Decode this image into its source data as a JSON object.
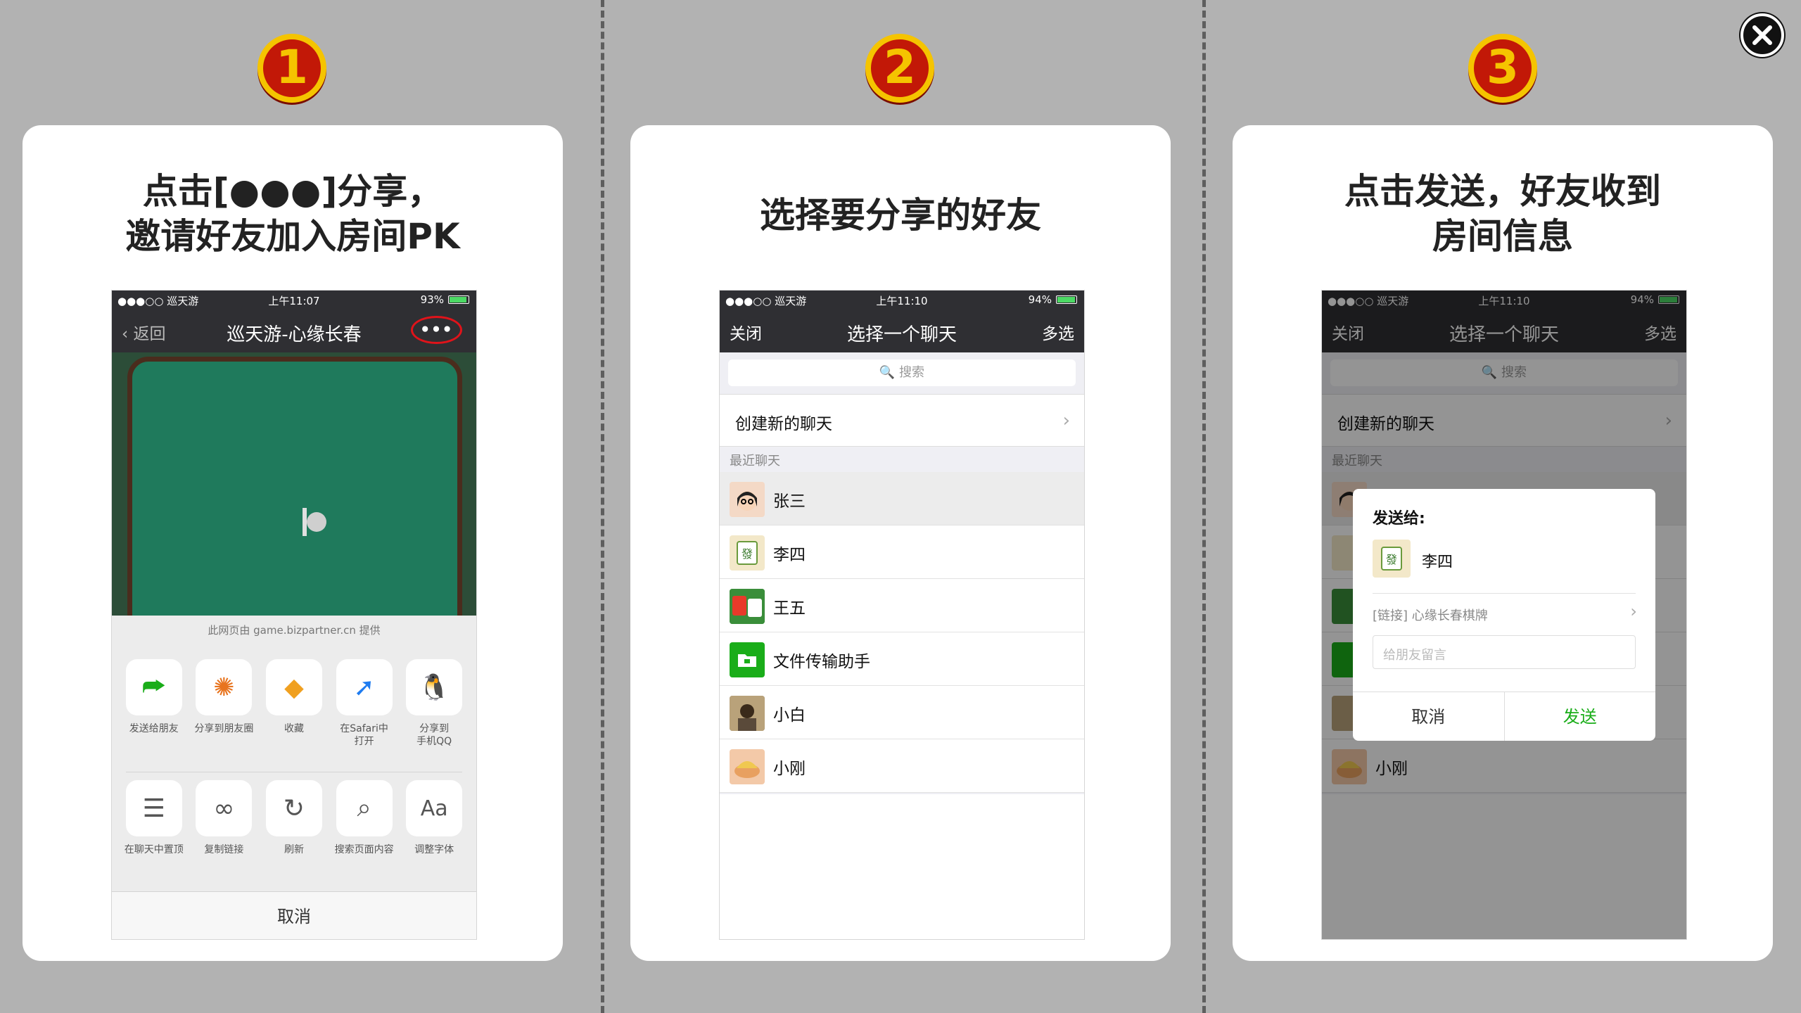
{
  "close_icon": "close-icon",
  "steps": [
    {
      "number": "1",
      "title": "点击[●●●]分享，\n邀请好友加入房间PK"
    },
    {
      "number": "2",
      "title": "选择要分享的好友"
    },
    {
      "number": "3",
      "title": "点击发送，好友收到\n房间信息"
    }
  ],
  "phone1": {
    "status": {
      "carrier": "●●●○○ 巡天游",
      "time": "上午11:07",
      "battery": "93%"
    },
    "nav": {
      "back": "‹ 返回",
      "title": "巡天游-心缘长春",
      "more": "•••"
    },
    "sheet": {
      "source": "此网页由 game.bizpartner.cn 提供",
      "row1": [
        {
          "label": "发送给朋友",
          "icon": "share-arrow-icon",
          "glyph": "⮫"
        },
        {
          "label": "分享到朋友圈",
          "icon": "moments-icon",
          "glyph": "✺"
        },
        {
          "label": "收藏",
          "icon": "favorite-cube-icon",
          "glyph": "◆"
        },
        {
          "label": "在Safari中\n打开",
          "icon": "safari-compass-icon",
          "glyph": "➚"
        },
        {
          "label": "分享到\n手机QQ",
          "icon": "qq-penguin-icon",
          "glyph": "🐧"
        }
      ],
      "row2": [
        {
          "label": "在聊天中置顶",
          "icon": "pin-top-icon",
          "glyph": "☰"
        },
        {
          "label": "复制链接",
          "icon": "link-icon",
          "glyph": "∞"
        },
        {
          "label": "刷新",
          "icon": "refresh-icon",
          "glyph": "↻"
        },
        {
          "label": "搜索页面内容",
          "icon": "search-icon",
          "glyph": "⌕"
        },
        {
          "label": "调整字体",
          "icon": "font-size-icon",
          "glyph": "Aa"
        }
      ],
      "cancel": "取消"
    }
  },
  "phone2": {
    "status": {
      "carrier": "●●●○○ 巡天游",
      "time": "上午11:10",
      "battery": "94%"
    },
    "nav": {
      "left": "关闭",
      "title": "选择一个聊天",
      "right": "多选"
    },
    "search_placeholder": "🔍 搜索",
    "new_chat": "创建新的聊天",
    "recent_label": "最近聊天",
    "contacts": [
      "张三",
      "李四",
      "王五",
      "文件传输助手",
      "小白",
      "小刚"
    ]
  },
  "phone3": {
    "status": {
      "carrier": "●●●○○ 巡天游",
      "time": "上午11:10",
      "battery": "94%"
    },
    "nav": {
      "left": "关闭",
      "title": "选择一个聊天",
      "right": "多选"
    },
    "search_placeholder": "🔍 搜索",
    "new_chat": "创建新的聊天",
    "recent_label": "最近聊天",
    "contacts": [
      "",
      "",
      "",
      "",
      "",
      "小刚"
    ],
    "dialog": {
      "title": "发送给:",
      "recipient": "李四",
      "link": "[链接] 心缘长春棋牌",
      "placeholder": "给朋友留言",
      "cancel": "取消",
      "send": "发送"
    }
  },
  "colors": {
    "background": "#b2b2b2",
    "accent_red": "#c21807",
    "accent_gold": "#f5c400",
    "send_green": "#1aad19",
    "nav_dark": "#2f2f33"
  }
}
